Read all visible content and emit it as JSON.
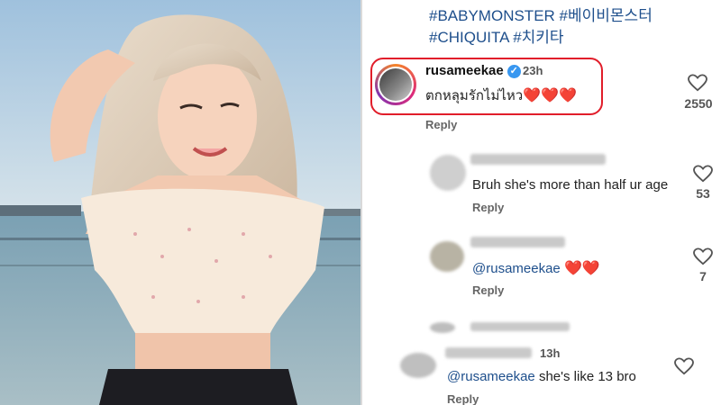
{
  "post": {
    "hashtags": [
      "#BABYMONSTER #베이비몬스터",
      "#CHIQUITA #치키타"
    ]
  },
  "comments": [
    {
      "username": "rusameekae",
      "verified": true,
      "time": "23h",
      "text": "ตกหลุมรักไม่ไหว",
      "emoji": "❤️❤️❤️",
      "reply_label": "Reply",
      "likes": "2550",
      "highlighted": true
    },
    {
      "username": "",
      "text": "Bruh she's more than half ur age",
      "reply_label": "Reply",
      "likes": "53"
    },
    {
      "username": "",
      "mention": "@rusameekae",
      "emoji": "❤️❤️",
      "reply_label": "Reply",
      "likes": "7"
    },
    {
      "username": "",
      "time": "13h",
      "mention": "@rusameekae",
      "text": " she's like 13 bro",
      "reply_label": "Reply"
    }
  ],
  "colors": {
    "highlight_border": "#e11d2a",
    "hashtag": "#1e4f8c",
    "verified": "#3897f0"
  }
}
